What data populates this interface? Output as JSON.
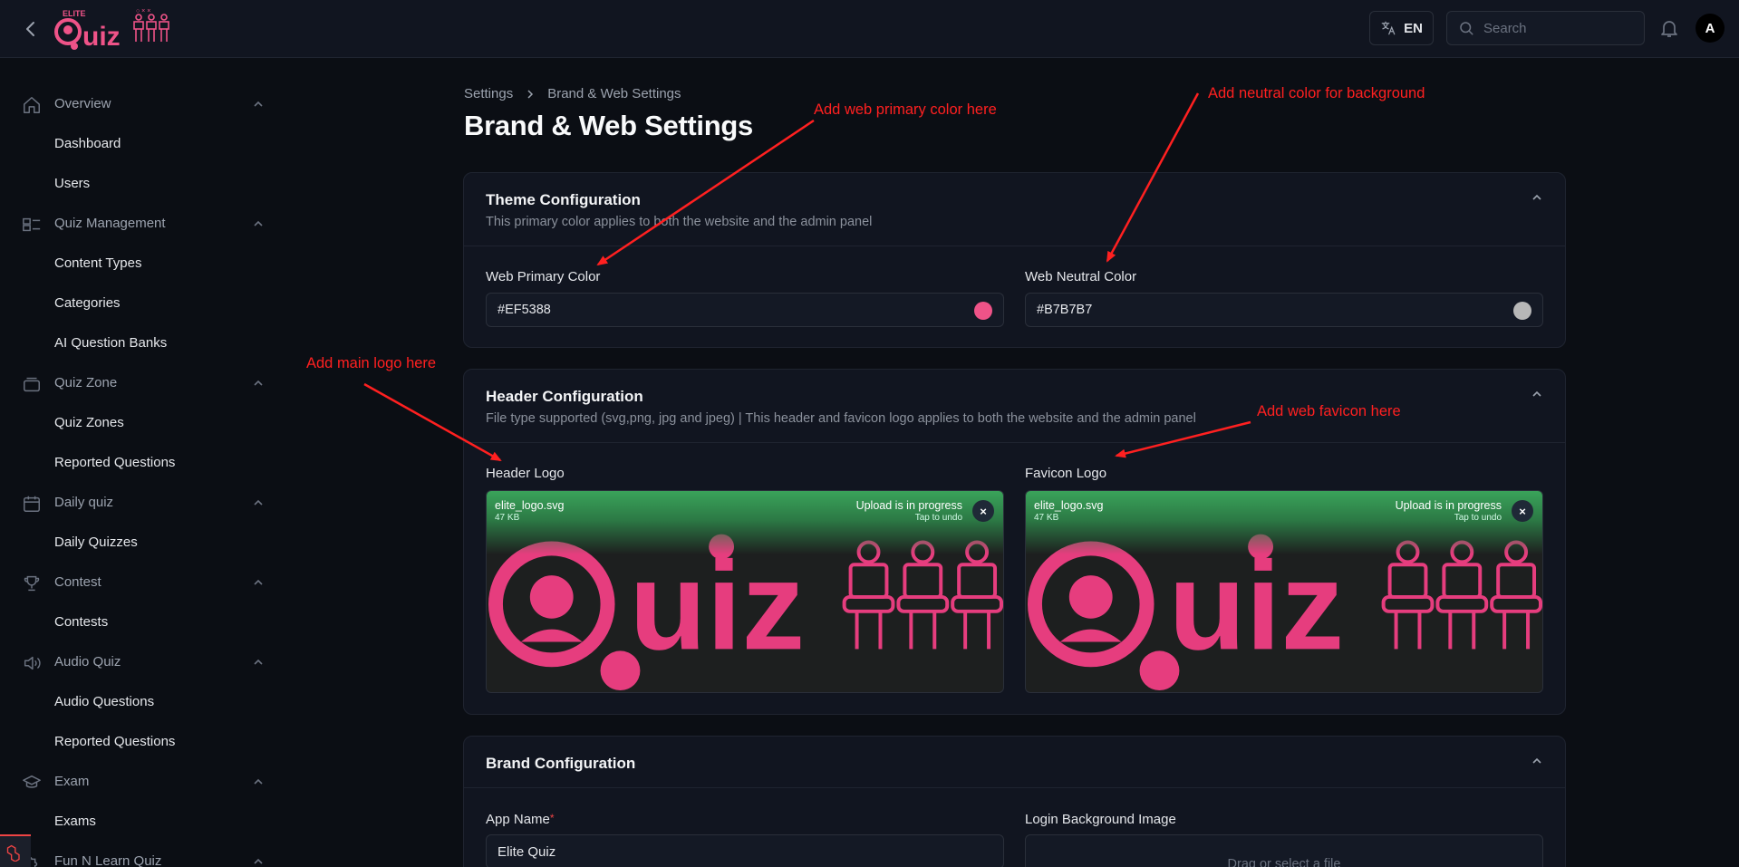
{
  "topbar": {
    "logo_small_text": "ELITE",
    "logo_text": "Quiz",
    "lang_label": "EN",
    "search_placeholder": "Search",
    "avatar_initial": "A"
  },
  "sidebar": {
    "groups": [
      {
        "label": "Overview",
        "icon": "home-icon",
        "items": [
          "Dashboard",
          "Users"
        ]
      },
      {
        "label": "Quiz Management",
        "icon": "layout-icon",
        "items": [
          "Content Types",
          "Categories",
          "AI Question Banks"
        ]
      },
      {
        "label": "Quiz Zone",
        "icon": "stack-icon",
        "items": [
          "Quiz Zones",
          "Reported Questions"
        ]
      },
      {
        "label": "Daily quiz",
        "icon": "calendar-icon",
        "items": [
          "Daily Quizzes"
        ]
      },
      {
        "label": "Contest",
        "icon": "trophy-icon",
        "items": [
          "Contests"
        ]
      },
      {
        "label": "Audio Quiz",
        "icon": "speaker-icon",
        "items": [
          "Audio Questions",
          "Reported Questions"
        ]
      },
      {
        "label": "Exam",
        "icon": "graduation-cap-icon",
        "items": [
          "Exams"
        ]
      },
      {
        "label": "Fun N Learn Quiz",
        "icon": "puzzle-icon",
        "items": []
      }
    ]
  },
  "breadcrumb": {
    "items": [
      "Settings",
      "Brand & Web Settings"
    ]
  },
  "page_title": "Brand & Web Settings",
  "theme_config": {
    "title": "Theme Configuration",
    "description": "This primary color applies to both the website and the admin panel",
    "primary_label": "Web Primary Color",
    "primary_value": "#EF5388",
    "neutral_label": "Web Neutral Color",
    "neutral_value": "#B7B7B7"
  },
  "header_config": {
    "title": "Header Configuration",
    "description": "File type supported (svg,png, jpg and jpeg) | This header and favicon logo applies to both the website and the admin panel",
    "header_logo_label": "Header Logo",
    "favicon_logo_label": "Favicon Logo",
    "uploads": [
      {
        "file_name": "elite_logo.svg",
        "file_size": "47 KB",
        "status": "Upload is in progress",
        "undo": "Tap to undo"
      },
      {
        "file_name": "elite_logo.svg",
        "file_size": "47 KB",
        "status": "Upload is in progress",
        "undo": "Tap to undo"
      }
    ],
    "close_symbol": "×"
  },
  "brand_config": {
    "title": "Brand Configuration",
    "app_name_label": "App Name",
    "required_mark": "*",
    "app_name_value": "Elite Quiz",
    "login_bg_label": "Login Background Image",
    "drop_text": "Drag or select a file"
  },
  "annotations": {
    "primary": "Add web primary color here",
    "neutral": "Add neutral color for background",
    "main_logo": "Add main logo here",
    "favicon": "Add web favicon here"
  },
  "colors": {
    "primary": "#EF5388",
    "neutral": "#B7B7B7",
    "annotation": "#FF2020",
    "upload_progress": "#3AA35A"
  }
}
